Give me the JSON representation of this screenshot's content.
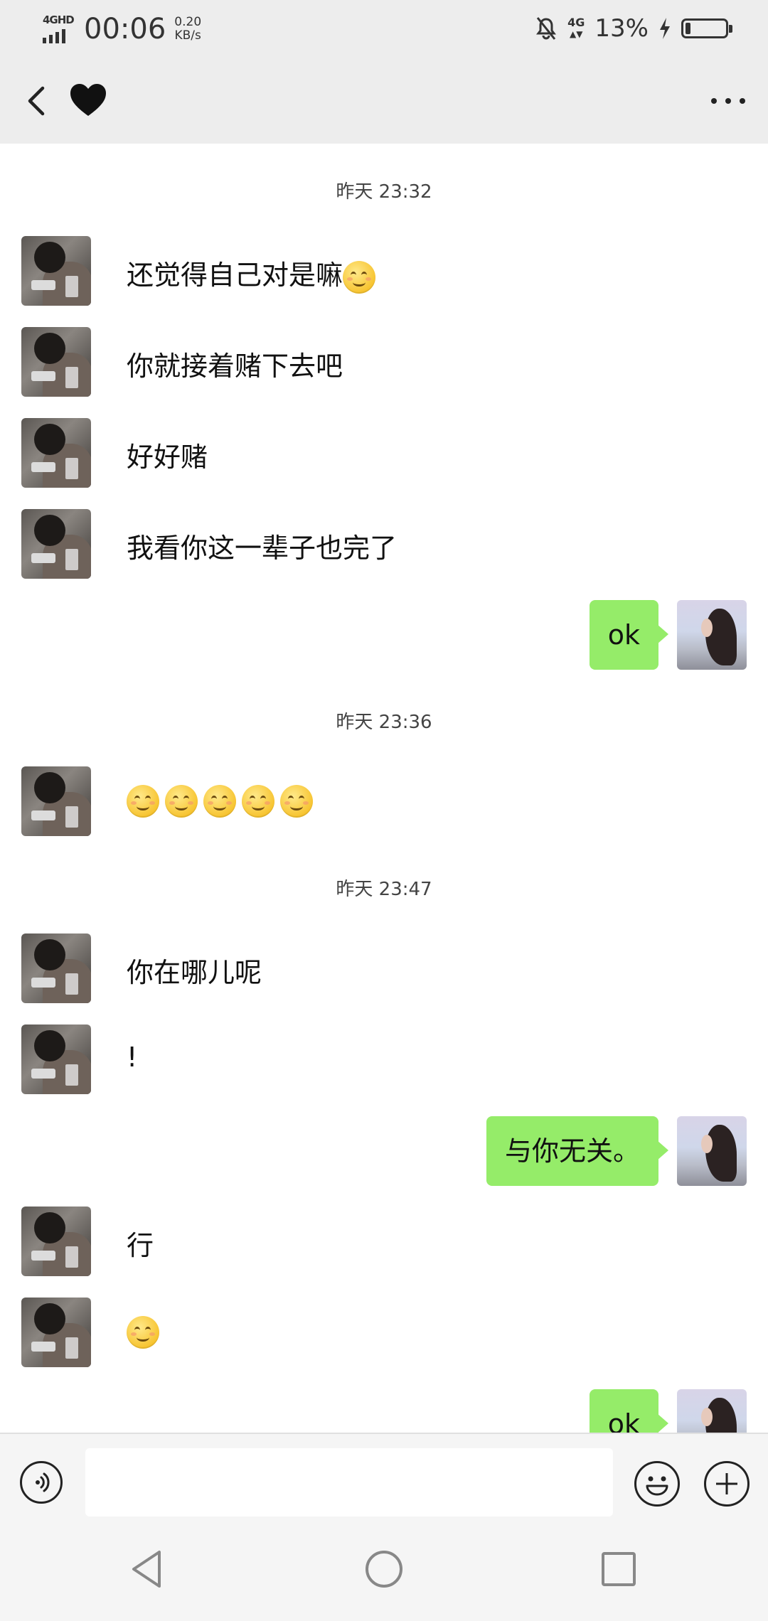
{
  "status_bar": {
    "network_label": "4GHD",
    "time": "00:06",
    "speed_value": "0.20",
    "speed_unit": "KB/s",
    "mobile_data": "4G",
    "battery_percent": "13%",
    "battery_level": 0.13
  },
  "header": {
    "contact_icon": "black-heart-icon",
    "back_icon": "chevron-left-icon",
    "more_icon": "more-dots-icon"
  },
  "timestamps": [
    "昨天 23:32",
    "昨天 23:36",
    "昨天 23:47"
  ],
  "messages": [
    {
      "from": "them",
      "text": "还觉得自己对是嘛",
      "emoji_count": 1
    },
    {
      "from": "them",
      "text": "你就接着赌下去吧",
      "emoji_count": 0
    },
    {
      "from": "them",
      "text": "好好赌",
      "emoji_count": 0
    },
    {
      "from": "them",
      "text": "我看你这一辈子也完了",
      "emoji_count": 0
    },
    {
      "from": "me",
      "text": "ok"
    },
    {
      "from": "them",
      "text": "",
      "emoji_count": 5
    },
    {
      "from": "them",
      "text": "你在哪儿呢",
      "emoji_count": 0
    },
    {
      "from": "them",
      "text": "!",
      "emoji_count": 0
    },
    {
      "from": "me",
      "text": "与你无关。"
    },
    {
      "from": "them",
      "text": "行",
      "emoji_count": 0
    },
    {
      "from": "them",
      "text": "",
      "emoji_count": 1
    },
    {
      "from": "me",
      "text": "ok"
    }
  ],
  "input_bar": {
    "voice_icon": "voice-input-icon",
    "emoji_icon": "emoji-icon",
    "plus_icon": "plus-icon",
    "placeholder": ""
  },
  "nav_bar": {
    "back_icon": "nav-back-triangle-icon",
    "home_icon": "nav-home-circle-icon",
    "recents_icon": "nav-recents-square-icon"
  },
  "colors": {
    "header_bg": "#ededed",
    "sent_bubble": "#95ec69",
    "chat_bg": "#ffffff"
  }
}
